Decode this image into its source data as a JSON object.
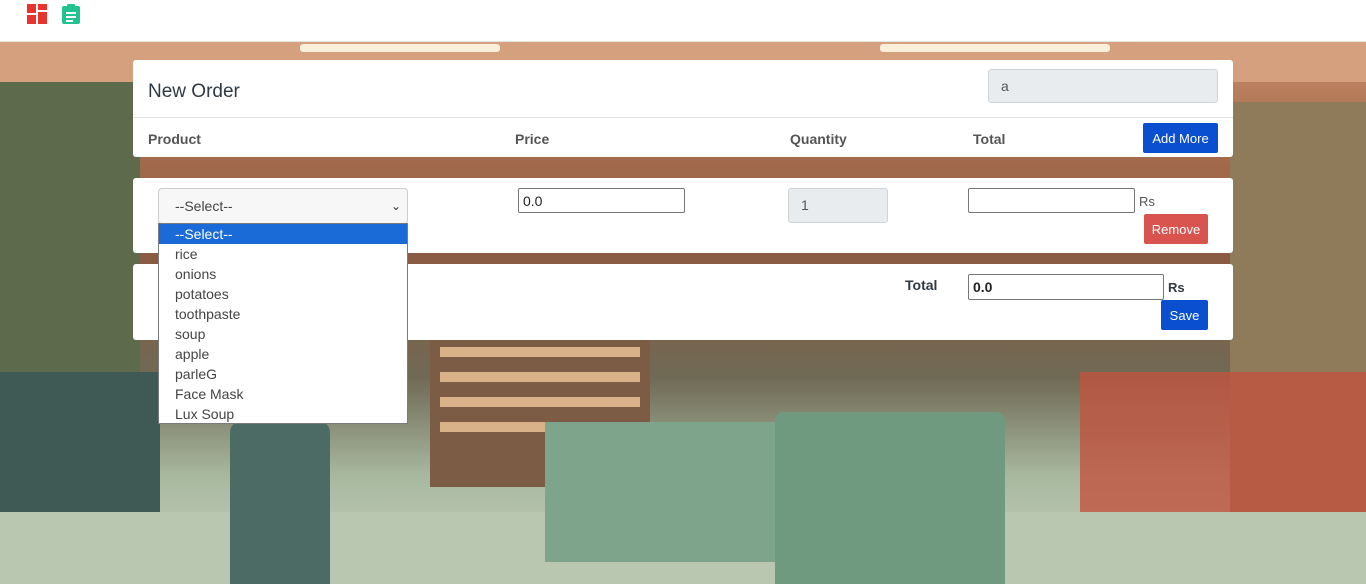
{
  "nav": {
    "icons": [
      "dashboard-icon",
      "clipboard-icon"
    ]
  },
  "order": {
    "title": "New Order",
    "customer_value": "a",
    "columns": {
      "product": "Product",
      "price": "Price",
      "quantity": "Quantity",
      "total": "Total"
    },
    "add_more_label": "Add More"
  },
  "row": {
    "product_selected": "--Select--",
    "price": "0.0",
    "quantity": "1",
    "total": "",
    "currency": "Rs",
    "remove_label": "Remove"
  },
  "dropdown": {
    "options": [
      "--Select--",
      "rice",
      "onions",
      "potatoes",
      "toothpaste",
      "soup",
      "apple",
      "parleG",
      "Face Mask",
      "Lux Soup"
    ],
    "selected_index": 0
  },
  "summary": {
    "total_label": "Total",
    "total_value": "0.0",
    "currency": "Rs",
    "save_label": "Save"
  },
  "colors": {
    "primary": "#0b4fd1",
    "danger": "#d9534f",
    "highlight": "#1a6ad8"
  }
}
